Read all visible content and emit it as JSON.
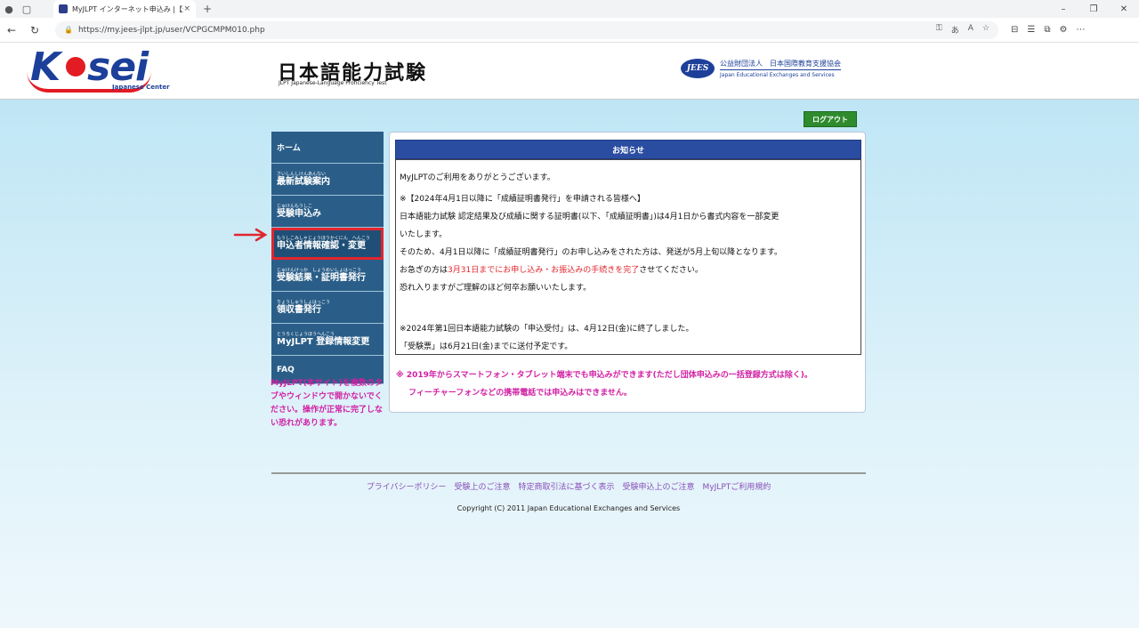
{
  "browser": {
    "tab_title": "MyJLPT インターネット申込み |【通",
    "tab_close": "×",
    "new_tab": "+",
    "url": "https://my.jees-jlpt.jp/user/VCPGCMPM010.php"
  },
  "header": {
    "kosei_logo": "K",
    "kosei_logo_rest": "sei",
    "kosei_sub": "Japanese Center",
    "jlpt_title": "日本語能力試験",
    "jlpt_sub": "JLPT Japanese-Language Proficiency Test",
    "jees_badge": "JEES",
    "jees_jp": "公益財団法人　日本国際教育支援協会",
    "jees_en": "Japan Educational Exchanges and Services"
  },
  "logout_label": "ログアウト",
  "sidebar": {
    "items": [
      {
        "ruby": "",
        "label": "ホーム"
      },
      {
        "ruby": "さいしんしけんあんない",
        "label": "最新試験案内"
      },
      {
        "ruby": "じゅけんもうしこ",
        "label": "受験申込み"
      },
      {
        "ruby": "もうしこみしゃじょうほうかくにん　へんこう",
        "label": "申込者情報確認・変更"
      },
      {
        "ruby": "じゅけんけっか　しょうめいしょはっこう",
        "label": "受験結果・証明書発行"
      },
      {
        "ruby": "りょうしゅうしょはっこう",
        "label": "領収書発行"
      },
      {
        "ruby": "とうろくじょうほうへんこう",
        "label": "MyJLPT 登録情報変更"
      },
      {
        "ruby": "",
        "label": "FAQ"
      }
    ],
    "note": "MyJLPT(本サイト)を複数のタブやウィンドウで開かないでください。操作が正常に完了しない恐れがあります。"
  },
  "notice": {
    "title": "お知らせ",
    "line1": "MyJLPTのご利用をありがとうございます。",
    "line2": "※【2024年4月1日以降に「成績証明書発行」を申請される皆様へ】",
    "line3": "日本語能力試験 認定結果及び成績に関する証明書(以下、「成績証明書」)は4月1日から書式内容を一部変更",
    "line4": "いたします。",
    "line5": "そのため、4月1日以降に「成績証明書発行」のお申し込みをされた方は、発送が5月上旬以降となります。",
    "line6_a": "お急ぎの方は",
    "line6_red": "3月31日までにお申し込み・お振込みの手続きを完了",
    "line6_b": "させてください。",
    "line7": "恐れ入りますがご理解のほど何卒お願いいたします。",
    "line8": "※2024年第1回日本語能力試験の「申込受付」は、4月12日(金)に終了しました。",
    "line9": "「受験票」は6月21日(金)までに送付予定です。"
  },
  "pink_note": {
    "line1": "※ 2019年からスマートフォン・タブレット端末でも申込みができます(ただし団体申込みの一括登録方式は除く)。",
    "line2": "フィーチャーフォンなどの携帯電話では申込みはできません。"
  },
  "footer": {
    "links": "プライバシーポリシー　受験上のご注意　特定商取引法に基づく表示　受験申込上のご注意　MyJLPTご利用規約",
    "copyright": "Copyright (C) 2011 Japan Educational Exchanges and Services"
  }
}
